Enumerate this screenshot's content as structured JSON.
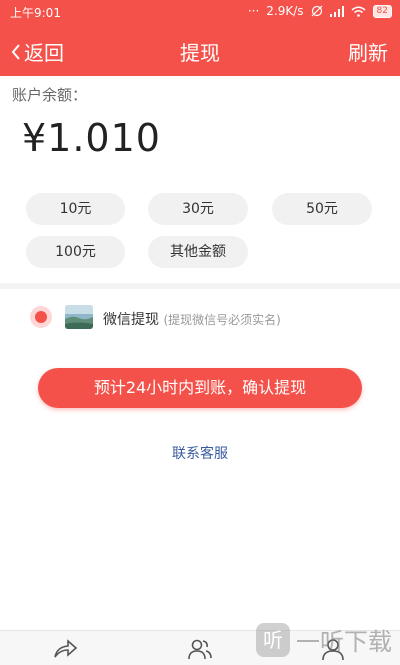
{
  "status_bar": {
    "time": "上午9:01",
    "dots": "···",
    "net_speed": "2.9K/s",
    "battery": "82"
  },
  "navbar": {
    "back_label": "返回",
    "title": "提现",
    "refresh_label": "刷新"
  },
  "balance": {
    "label": "账户余额：",
    "amount": "¥1.010"
  },
  "amount_options": [
    "10元",
    "30元",
    "50元",
    "100元",
    "其他金额"
  ],
  "withdraw_method": {
    "label": "微信提现",
    "note": "(提现微信号必须实名)"
  },
  "confirm_button": "预计24小时内到账，确认提现",
  "contact_service": "联系客服",
  "watermark": {
    "badge": "听",
    "text": "一听下载"
  },
  "colors": {
    "accent": "#f4514a",
    "link": "#3a5ba0"
  }
}
